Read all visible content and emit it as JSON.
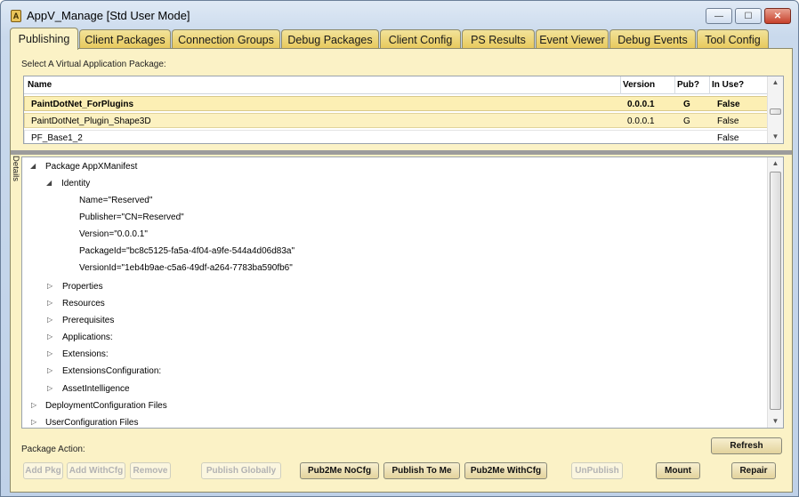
{
  "window": {
    "title": "AppV_Manage [Std User Mode]",
    "icon": "app-icon",
    "controls": {
      "minimize": "—",
      "maximize": "☐",
      "close": "✕"
    }
  },
  "tabs": [
    {
      "label": "Publishing",
      "active": true
    },
    {
      "label": "Client Packages"
    },
    {
      "label": "Connection Groups"
    },
    {
      "label": "Debug Packages"
    },
    {
      "label": "Client Config"
    },
    {
      "label": "PS Results"
    },
    {
      "label": "Event Viewer"
    },
    {
      "label": "Debug Events"
    },
    {
      "label": "Tool Config"
    }
  ],
  "publishing": {
    "select_label": "Select A Virtual Application Package:",
    "columns": {
      "name": "Name",
      "version": "Version",
      "pub": "Pub?",
      "inuse": "In Use?"
    },
    "rows": [
      {
        "name": "PaintDotNet_ForPlugins",
        "version": "0.0.0.1",
        "pub": "G",
        "inuse": "False",
        "selected": true
      },
      {
        "name": "PaintDotNet_Plugin_Shape3D",
        "version": "0.0.0.1",
        "pub": "G",
        "inuse": "False"
      },
      {
        "name": "PF_Base1_2",
        "version": "",
        "pub": "",
        "inuse": "False"
      }
    ],
    "details_label": "Details",
    "tree": {
      "root": "Package AppXManifest",
      "identity": "Identity",
      "identity_attrs": [
        "Name=\"Reserved\"",
        "Publisher=\"CN=Reserved\"",
        "Version=\"0.0.0.1\"",
        "PackageId=\"bc8c5125-fa5a-4f04-a9fe-544a4d06d83a\"",
        "VersionId=\"1eb4b9ae-c5a6-49df-a264-7783ba590fb6\""
      ],
      "children": [
        "Properties",
        "Resources",
        "Prerequisites",
        "Applications:",
        "Extensions:",
        "ExtensionsConfiguration:",
        "AssetIntelligence"
      ],
      "top_level": [
        "DeploymentConfiguration Files",
        "UserConfiguration Files"
      ]
    },
    "package_action_label": "Package Action:",
    "buttons": {
      "refresh": "Refresh",
      "add_pkg": "Add Pkg",
      "add_withcfg": "Add WithCfg",
      "remove": "Remove",
      "publish_globally": "Publish Globally",
      "pub2me_nocfg": "Pub2Me NoCfg",
      "publish_to_me": "Publish To Me",
      "pub2me_withcfg": "Pub2Me WithCfg",
      "unpublish": "UnPublish",
      "mount": "Mount",
      "repair": "Repair"
    }
  }
}
